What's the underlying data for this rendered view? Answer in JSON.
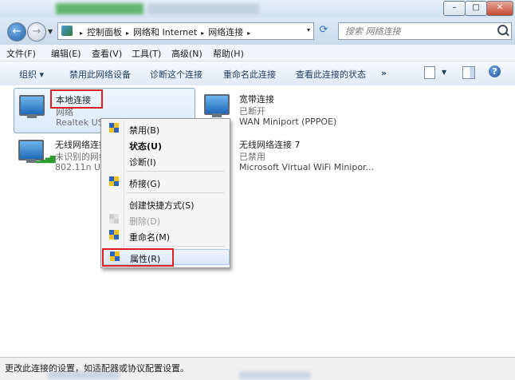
{
  "window": {
    "min_glyph": "–",
    "max_glyph": "□",
    "close_glyph": "✕"
  },
  "address": {
    "crumbs": [
      "控制面板",
      "网络和 Internet",
      "网络连接"
    ],
    "sep": "▸",
    "dropdown": "▾"
  },
  "search": {
    "placeholder": "搜索 网络连接"
  },
  "menu": [
    "文件(F)",
    "编辑(E)",
    "查看(V)",
    "工具(T)",
    "高级(N)",
    "帮助(H)"
  ],
  "toolbar": {
    "organize": "组织 ▾",
    "disable": "禁用此网络设备",
    "diagnose": "诊断这个连接",
    "rename": "重命名此连接",
    "view_status": "查看此连接的状态",
    "more": "»"
  },
  "connections": [
    {
      "name": "本地连接",
      "status": "网络",
      "device": "Realtek USB FE Family Controller"
    },
    {
      "name": "宽带连接",
      "status": "已断开",
      "device": "WAN Miniport (PPPOE)"
    },
    {
      "name": "无线网络连接",
      "status": "未识别的网络",
      "device": "802.11n USB Wireless LAN Card"
    },
    {
      "name": "无线网络连接 7",
      "status": "已禁用",
      "device": "Microsoft Virtual WiFi Minipor..."
    }
  ],
  "context_menu": [
    {
      "label": "禁用(B)",
      "icon": "shield-icon"
    },
    {
      "label": "状态(U)",
      "bold": true
    },
    {
      "label": "诊断(I)"
    },
    {
      "label": "桥接(G)",
      "icon": "shield-icon"
    },
    {
      "label": "创建快捷方式(S)"
    },
    {
      "label": "删除(D)",
      "icon": "shield-icon",
      "disabled": true
    },
    {
      "label": "重命名(M)",
      "icon": "shield-icon"
    },
    {
      "label": "属性(R)",
      "icon": "shield-icon",
      "highlighted": true
    }
  ],
  "status_bar": "更改此连接的设置，如适配器或协议配置设置。",
  "colors": {
    "highlight_box": "#e02020",
    "selection": "#dbeafb"
  }
}
